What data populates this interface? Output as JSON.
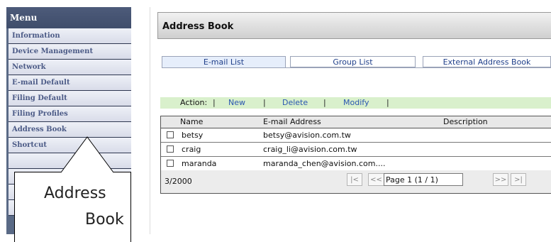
{
  "menu": {
    "header": "Menu",
    "items": [
      {
        "label": "Information"
      },
      {
        "label": "Device Management"
      },
      {
        "label": "Network"
      },
      {
        "label": "E-mail Default"
      },
      {
        "label": "Filing Default"
      },
      {
        "label": "Filing Profiles"
      },
      {
        "label": "Address Book"
      },
      {
        "label": "Shortcut"
      }
    ]
  },
  "callout": {
    "line1": "Address",
    "line2": "Book"
  },
  "panel": {
    "title": "Address Book",
    "tabs": [
      {
        "label": "E-mail List",
        "active": true
      },
      {
        "label": "Group List",
        "active": false
      },
      {
        "label": "External Address Book",
        "active": false
      }
    ],
    "actions": {
      "label": "Action:",
      "new": "New",
      "delete": "Delete",
      "modify": "Modify"
    },
    "table": {
      "columns": {
        "name": "Name",
        "email": "E-mail Address",
        "description": "Description"
      },
      "rows": [
        {
          "name": "betsy",
          "email": "betsy@avision.com.tw",
          "description": ""
        },
        {
          "name": "craig",
          "email": "craig_li@avision.com.tw",
          "description": ""
        },
        {
          "name": "maranda",
          "email": "maranda_chen@avision.com....",
          "description": ""
        }
      ],
      "count": "3/2000",
      "pager": {
        "first": "|<",
        "prev": "<<",
        "page_value": "Page 1 (1 / 1)",
        "next": ">>",
        "last": ">|"
      }
    }
  },
  "colors": {
    "menu_bg": "#5a6a86",
    "menu_text": "#4b5a86",
    "action_bar": "#d9f0cc",
    "link": "#2a56b0"
  }
}
